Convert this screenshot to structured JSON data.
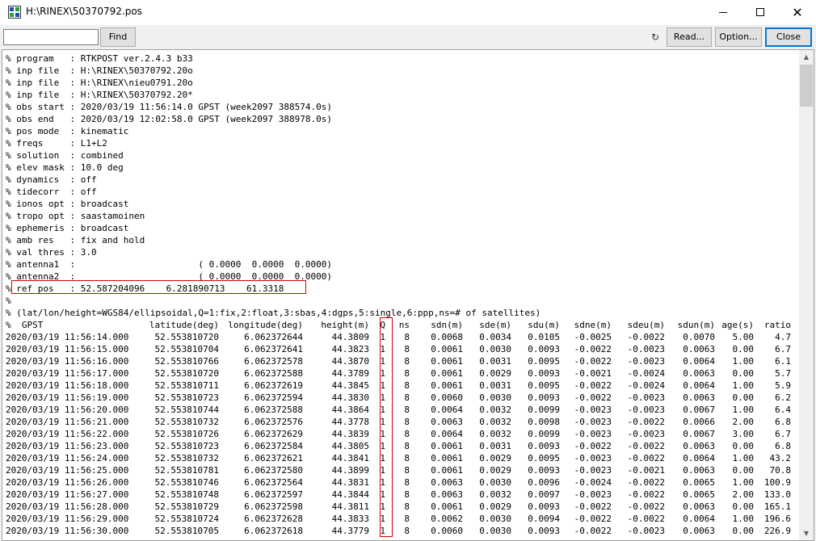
{
  "window": {
    "title": "H:\\RINEX\\50370792.pos",
    "app_icon": "rtkpost-app-icon",
    "minimize_icon": "minimize-icon",
    "maximize_icon": "maximize-icon",
    "close_glyph": "✕"
  },
  "toolbar": {
    "search_value": "",
    "find_label": "Find",
    "refresh_glyph": "↻",
    "read_label": "Read...",
    "option_label": "Option...",
    "close_label": "Close"
  },
  "header_lines": [
    "% program   : RTKPOST ver.2.4.3 b33",
    "% inp file  : H:\\RINEX\\50370792.20o",
    "% inp file  : H:\\RINEX\\nieu0791.20o",
    "% inp file  : H:\\RINEX\\50370792.20*",
    "% obs start : 2020/03/19 11:56:14.0 GPST (week2097 388574.0s)",
    "% obs end   : 2020/03/19 12:02:58.0 GPST (week2097 388978.0s)",
    "% pos mode  : kinematic",
    "% freqs     : L1+L2",
    "% solution  : combined",
    "% elev mask : 10.0 deg",
    "% dynamics  : off",
    "% tidecorr  : off",
    "% ionos opt : broadcast",
    "% tropo opt : saastamoinen",
    "% ephemeris : broadcast",
    "% amb res   : fix and hold",
    "% val thres : 3.0",
    "% antenna1  :                       ( 0.0000  0.0000  0.0000)",
    "% antenna2  :                       ( 0.0000  0.0000  0.0000)",
    "% ref pos   : 52.587204096    6.281890713    61.3318",
    "%",
    "% (lat/lon/height=WGS84/ellipsoidal,Q=1:fix,2:float,3:sbas,4:dgps,5:single,6:ppp,ns=# of satellites)"
  ],
  "table": {
    "columns": [
      "%  GPST",
      "latitude(deg)",
      "longitude(deg)",
      "height(m)",
      "Q",
      "ns",
      "sdn(m)",
      "sde(m)",
      "sdu(m)",
      "sdne(m)",
      "sdeu(m)",
      "sdun(m)",
      "age(s)",
      "ratio"
    ],
    "rows": [
      [
        "2020/03/19 11:56:14.000",
        "52.553810720",
        "6.062372644",
        "44.3809",
        "1",
        "8",
        "0.0068",
        "0.0034",
        "0.0105",
        "-0.0025",
        "-0.0022",
        "0.0070",
        "5.00",
        "4.7"
      ],
      [
        "2020/03/19 11:56:15.000",
        "52.553810704",
        "6.062372641",
        "44.3823",
        "1",
        "8",
        "0.0061",
        "0.0030",
        "0.0093",
        "-0.0022",
        "-0.0023",
        "0.0063",
        "0.00",
        "6.7"
      ],
      [
        "2020/03/19 11:56:16.000",
        "52.553810766",
        "6.062372578",
        "44.3870",
        "1",
        "8",
        "0.0061",
        "0.0031",
        "0.0095",
        "-0.0022",
        "-0.0023",
        "0.0064",
        "1.00",
        "6.1"
      ],
      [
        "2020/03/19 11:56:17.000",
        "52.553810720",
        "6.062372588",
        "44.3789",
        "1",
        "8",
        "0.0061",
        "0.0029",
        "0.0093",
        "-0.0021",
        "-0.0024",
        "0.0063",
        "0.00",
        "5.7"
      ],
      [
        "2020/03/19 11:56:18.000",
        "52.553810711",
        "6.062372619",
        "44.3845",
        "1",
        "8",
        "0.0061",
        "0.0031",
        "0.0095",
        "-0.0022",
        "-0.0024",
        "0.0064",
        "1.00",
        "5.9"
      ],
      [
        "2020/03/19 11:56:19.000",
        "52.553810723",
        "6.062372594",
        "44.3830",
        "1",
        "8",
        "0.0060",
        "0.0030",
        "0.0093",
        "-0.0022",
        "-0.0023",
        "0.0063",
        "0.00",
        "6.2"
      ],
      [
        "2020/03/19 11:56:20.000",
        "52.553810744",
        "6.062372588",
        "44.3864",
        "1",
        "8",
        "0.0064",
        "0.0032",
        "0.0099",
        "-0.0023",
        "-0.0023",
        "0.0067",
        "1.00",
        "6.4"
      ],
      [
        "2020/03/19 11:56:21.000",
        "52.553810732",
        "6.062372576",
        "44.3778",
        "1",
        "8",
        "0.0063",
        "0.0032",
        "0.0098",
        "-0.0023",
        "-0.0022",
        "0.0066",
        "2.00",
        "6.8"
      ],
      [
        "2020/03/19 11:56:22.000",
        "52.553810726",
        "6.062372629",
        "44.3839",
        "1",
        "8",
        "0.0064",
        "0.0032",
        "0.0099",
        "-0.0023",
        "-0.0023",
        "0.0067",
        "3.00",
        "6.7"
      ],
      [
        "2020/03/19 11:56:23.000",
        "52.553810723",
        "6.062372584",
        "44.3805",
        "1",
        "8",
        "0.0061",
        "0.0031",
        "0.0093",
        "-0.0022",
        "-0.0022",
        "0.0063",
        "0.00",
        "6.8"
      ],
      [
        "2020/03/19 11:56:24.000",
        "52.553810732",
        "6.062372621",
        "44.3841",
        "1",
        "8",
        "0.0061",
        "0.0029",
        "0.0095",
        "-0.0023",
        "-0.0022",
        "0.0064",
        "1.00",
        "43.2"
      ],
      [
        "2020/03/19 11:56:25.000",
        "52.553810781",
        "6.062372580",
        "44.3899",
        "1",
        "8",
        "0.0061",
        "0.0029",
        "0.0093",
        "-0.0023",
        "-0.0021",
        "0.0063",
        "0.00",
        "70.8"
      ],
      [
        "2020/03/19 11:56:26.000",
        "52.553810746",
        "6.062372564",
        "44.3831",
        "1",
        "8",
        "0.0063",
        "0.0030",
        "0.0096",
        "-0.0024",
        "-0.0022",
        "0.0065",
        "1.00",
        "100.9"
      ],
      [
        "2020/03/19 11:56:27.000",
        "52.553810748",
        "6.062372597",
        "44.3844",
        "1",
        "8",
        "0.0063",
        "0.0032",
        "0.0097",
        "-0.0023",
        "-0.0022",
        "0.0065",
        "2.00",
        "133.0"
      ],
      [
        "2020/03/19 11:56:28.000",
        "52.553810729",
        "6.062372598",
        "44.3811",
        "1",
        "8",
        "0.0061",
        "0.0029",
        "0.0093",
        "-0.0022",
        "-0.0022",
        "0.0063",
        "0.00",
        "165.1"
      ],
      [
        "2020/03/19 11:56:29.000",
        "52.553810724",
        "6.062372628",
        "44.3833",
        "1",
        "8",
        "0.0062",
        "0.0030",
        "0.0094",
        "-0.0022",
        "-0.0022",
        "0.0064",
        "1.00",
        "196.6"
      ],
      [
        "2020/03/19 11:56:30.000",
        "52.553810705",
        "6.062372618",
        "44.3779",
        "1",
        "8",
        "0.0060",
        "0.0030",
        "0.0093",
        "-0.0022",
        "-0.0023",
        "0.0063",
        "0.00",
        "226.9"
      ]
    ]
  },
  "scrollbar": {
    "up_glyph": "▲",
    "down_glyph": "▼",
    "position_fraction": 0.0
  },
  "colors": {
    "annotation_red": "#d40000",
    "close_focus": "#0078d7"
  }
}
